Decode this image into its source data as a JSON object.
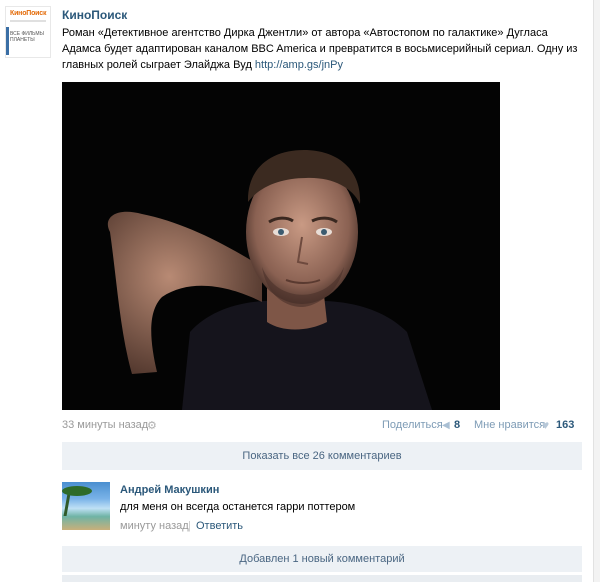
{
  "post": {
    "group_name": "КиноПоиск",
    "avatar": {
      "logo": "КиноПоиск",
      "subtitle": "Все фильмы планеты"
    },
    "text": "Роман «Детективное агентство Дирка Джентли» от автора «Автостопом по галактике» Дугласа Адамса будет адаптирован каналом BBC America и превратится в восьмисерийный сериал. Одну из главных ролей сыграет Элайджа Вуд ",
    "link": "http://amp.gs/jnPy",
    "time": "33 минуты назад",
    "share_label": "Поделиться",
    "share_count": "8",
    "like_label": "Мне нравится",
    "like_count": "163",
    "show_all_comments": "Показать все 26 комментариев"
  },
  "comment": {
    "author": "Андрей Макушкин",
    "text": "для меня он всегда останется гарри поттером",
    "time": "минуту назад",
    "separator": "|",
    "reply_label": "Ответить"
  },
  "new_comment_bar": "Добавлен 1 новый комментарий",
  "icons": {
    "time": "gear-icon",
    "share": "megaphone-icon",
    "like": "heart-icon"
  },
  "colors": {
    "link": "#2b587a",
    "bar_bg": "#edf1f5",
    "muted": "#999999"
  }
}
